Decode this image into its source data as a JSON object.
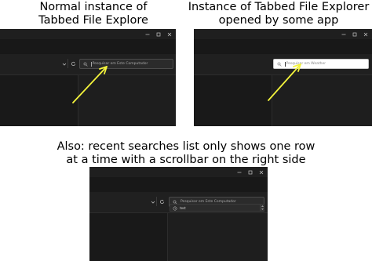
{
  "captions": {
    "normal_line1": "Normal instance of",
    "normal_line2": "Tabbed File Explore",
    "app_line1": "Instance of Tabbed File Explorer",
    "app_line2": "opened by some app",
    "also_line1": "Also: recent searches list only shows one row",
    "also_line2": "at a time with a scrollbar on the right side"
  },
  "windows": {
    "normal": {
      "search_placeholder": "Pesquisar em Este Computador"
    },
    "app": {
      "search_placeholder": "Pesquisar em Weather"
    },
    "bottom": {
      "search_placeholder": "Pesquisar em Este Computador",
      "recent_search": "test"
    }
  },
  "colors": {
    "window_bg": "#1b1b1b",
    "arrow": "#f4f43c",
    "search_dark": "#2b2b2b",
    "search_light": "#ffffff"
  },
  "icons": {
    "caption_buttons": [
      "minimize-icon",
      "maximize-icon",
      "close-icon"
    ],
    "toolbar": [
      "chevron-down-icon",
      "refresh-icon"
    ],
    "search": "search-icon",
    "history": "history-icon"
  }
}
